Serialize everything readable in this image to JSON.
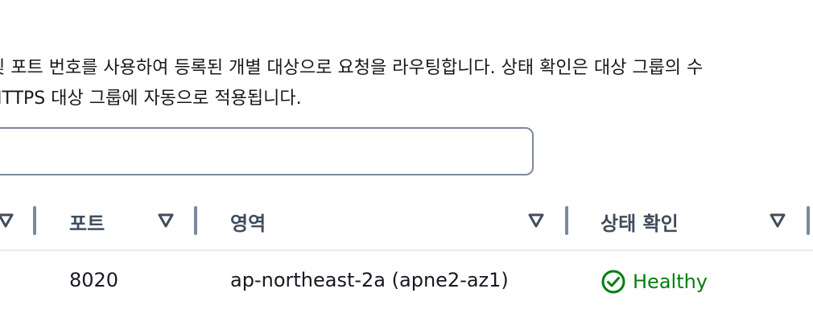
{
  "description": {
    "line1": "및 포트 번호를 사용하여 등록된 개별 대상으로 요청을 라우팅합니다. 상태 확인은 대상 그룹의 수",
    "line2": "HTTPS 대상 그룹에 자동으로 적용됩니다."
  },
  "search": {
    "placeholder": ""
  },
  "table": {
    "columns": [
      "포트",
      "영역",
      "상태 확인"
    ],
    "rows": [
      {
        "port": "8020",
        "zone": "ap-northeast-2a (apne2-az1)",
        "health": "Healthy"
      }
    ]
  },
  "colors": {
    "healthy": "#037f0c",
    "header_text": "#414d5c",
    "divider": "#7d8998"
  }
}
